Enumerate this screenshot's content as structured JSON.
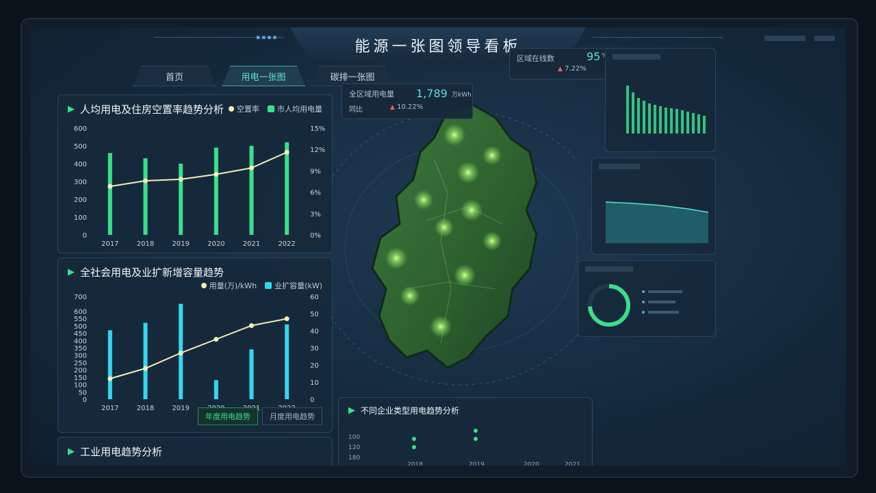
{
  "header": {
    "title": "能源一张图领导看板"
  },
  "tabs": [
    {
      "label": "首页",
      "active": false
    },
    {
      "label": "用电一张图",
      "active": true
    },
    {
      "label": "碳排一张图",
      "active": false
    }
  ],
  "map": {
    "card_total": {
      "label": "全区域用电量",
      "value": "1,789",
      "unit": "万kWh",
      "yoy_label": "同比",
      "yoy_value": "10.22%"
    },
    "card_right": {
      "label": "区域在线数",
      "value": "95",
      "unit": "%",
      "rate": "7.22%"
    }
  },
  "panel_per_capita": {
    "title": "人均用电及住房空置率趋势分析",
    "legend": [
      "空置率",
      "市人均用电量"
    ],
    "chart_data": {
      "type": "bar",
      "categories": [
        "2017",
        "2018",
        "2019",
        "2020",
        "2021",
        "2022"
      ],
      "series": [
        {
          "name": "市人均用电量",
          "kind": "bar",
          "axis": "left",
          "values": [
            460,
            430,
            400,
            490,
            500,
            520
          ]
        },
        {
          "name": "空置率",
          "kind": "line",
          "axis": "right",
          "values": [
            6.8,
            7.6,
            7.8,
            8.5,
            9.4,
            11.6
          ]
        }
      ],
      "y_left": {
        "ticks": [
          0,
          100,
          200,
          300,
          400,
          500,
          600
        ],
        "ylim": [
          0,
          600
        ]
      },
      "y_right": {
        "ticks": [
          "0%",
          "3%",
          "6%",
          "9%",
          "12%",
          "15%"
        ],
        "ylim": [
          0,
          15
        ]
      },
      "colors": {
        "bar": "#39e08a",
        "line": "#f2efb8"
      }
    }
  },
  "panel_society": {
    "title": "全社会用电及业扩新增容量趋势",
    "legend": [
      "用量(万)/kWh",
      "业扩容量(kW)"
    ],
    "chart_data": {
      "type": "bar",
      "categories": [
        "2017",
        "2018",
        "2019",
        "2020",
        "2021",
        "2022"
      ],
      "series": [
        {
          "name": "业扩容量(kW)",
          "kind": "bar",
          "axis": "left",
          "values": [
            470,
            520,
            650,
            130,
            340,
            510
          ]
        },
        {
          "name": "用量(万)/kWh",
          "kind": "line",
          "axis": "right",
          "values": [
            12,
            18,
            27,
            35,
            43,
            47
          ]
        }
      ],
      "y_left": {
        "ticks": [
          0,
          50,
          100,
          150,
          200,
          250,
          300,
          350,
          400,
          450,
          500,
          550,
          600,
          700
        ],
        "ylim": [
          0,
          700
        ]
      },
      "y_right": {
        "ticks": [
          0,
          10,
          20,
          30,
          40,
          50,
          60
        ],
        "ylim": [
          0,
          60
        ]
      },
      "colors": {
        "bar": "#36d6ef",
        "line": "#f2efb8"
      }
    },
    "sub_tabs": [
      {
        "label": "年度用电趋势",
        "active": true
      },
      {
        "label": "月度用电趋势",
        "active": false
      }
    ]
  },
  "panel_industry": {
    "title": "工业用电趋势分析"
  },
  "panel_enterprise": {
    "title": "不同企业类型用电趋势分析",
    "axis_labels": [
      "100",
      "120",
      "180"
    ],
    "years": [
      "2018",
      "2019",
      "2020",
      "2021"
    ]
  }
}
